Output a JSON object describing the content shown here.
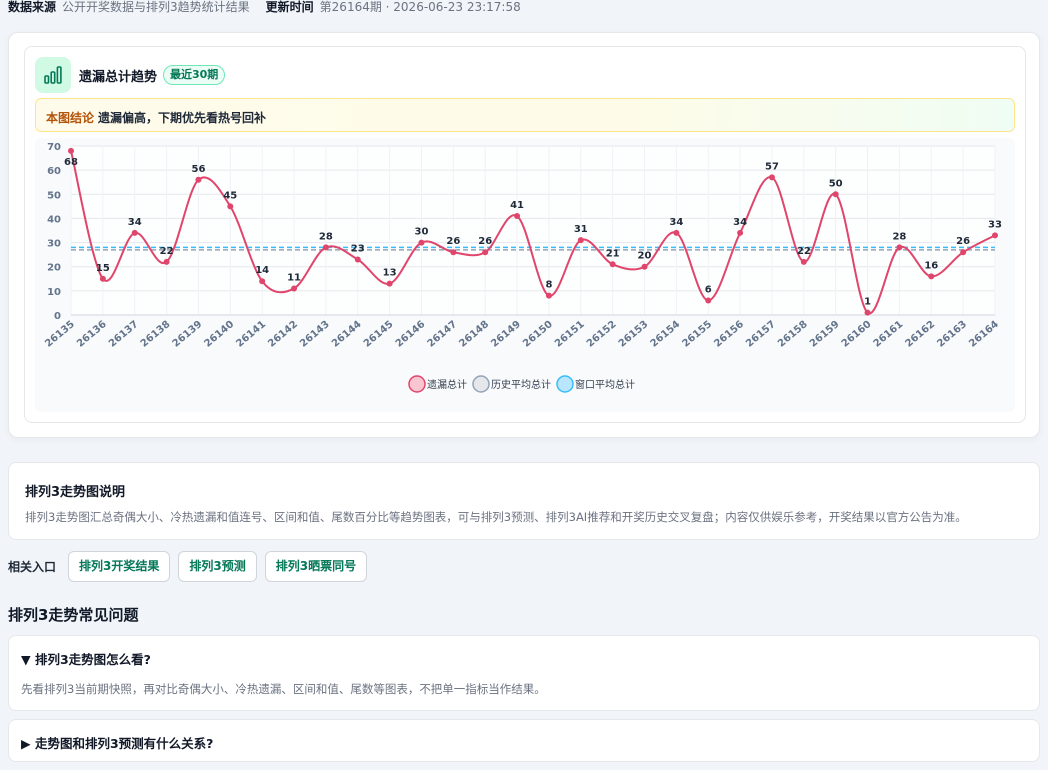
{
  "meta": {
    "source_label": "数据来源",
    "source_value": "公开开奖数据与排列3趋势统计结果",
    "updated_label": "更新时间",
    "updated_value": "第26164期 · 2026-06-23 23:17:58"
  },
  "chart_card": {
    "title": "遗漏总计趋势",
    "badge": "最近30期",
    "icon": "bar-chart-icon",
    "conclusion_tag": "本图结论",
    "conclusion_text": "遗漏偏高，下期优先看热号回补"
  },
  "colors": {
    "accent": "#047857",
    "series_line": "#e0456b",
    "avg_historical": "#94a3b8",
    "avg_window": "#38bdf8"
  },
  "chart_data": {
    "type": "line",
    "x": [
      "26135",
      "26136",
      "26137",
      "26138",
      "26139",
      "26140",
      "26141",
      "26142",
      "26143",
      "26144",
      "26145",
      "26146",
      "26147",
      "26148",
      "26149",
      "26150",
      "26151",
      "26152",
      "26153",
      "26154",
      "26155",
      "26156",
      "26157",
      "26158",
      "26159",
      "26160",
      "26161",
      "26162",
      "26163",
      "26164"
    ],
    "series": [
      {
        "name": "遗漏总计",
        "values": [
          68,
          15,
          34,
          22,
          56,
          45,
          14,
          11,
          28,
          23,
          13,
          30,
          26,
          26,
          41,
          8,
          31,
          21,
          20,
          34,
          6,
          34,
          57,
          22,
          50,
          1,
          28,
          16,
          26,
          33
        ]
      },
      {
        "name": "历史平均总计",
        "values": [
          27,
          27,
          27,
          27,
          27,
          27,
          27,
          27,
          27,
          27,
          27,
          27,
          27,
          27,
          27,
          27,
          27,
          27,
          27,
          27,
          27,
          27,
          27,
          27,
          27,
          27,
          27,
          27,
          27,
          27
        ]
      },
      {
        "name": "窗口平均总计",
        "values": [
          28,
          28,
          28,
          28,
          28,
          28,
          28,
          28,
          28,
          28,
          28,
          28,
          28,
          28,
          28,
          28,
          28,
          28,
          28,
          28,
          28,
          28,
          28,
          28,
          28,
          28,
          28,
          28,
          28,
          28
        ]
      }
    ],
    "yticks": [
      0,
      10,
      20,
      30,
      40,
      50,
      60,
      70
    ],
    "ylim": [
      0,
      70
    ],
    "grid": true,
    "legend": "bottom"
  },
  "description": {
    "title": "排列3走势图说明",
    "text": "排列3走势图汇总奇偶大小、冷热遗漏和值连号、区间和值、尾数百分比等趋势图表，可与排列3预测、排列3AI推荐和开奖历史交叉复盘；内容仅供娱乐参考，开奖结果以官方公告为准。"
  },
  "links": {
    "label": "相关入口",
    "items": [
      "排列3开奖结果",
      "排列3预测",
      "排列3晒票同号"
    ]
  },
  "faq": {
    "title": "排列3走势常见问题",
    "items": [
      {
        "q": "▼ 排列3走势图怎么看?",
        "a": "先看排列3当前期快照，再对比奇偶大小、冷热遗漏、区间和值、尾数等图表，不把单一指标当作结果。"
      },
      {
        "q": "▶ 走势图和排列3预测有什么关系?"
      }
    ]
  }
}
